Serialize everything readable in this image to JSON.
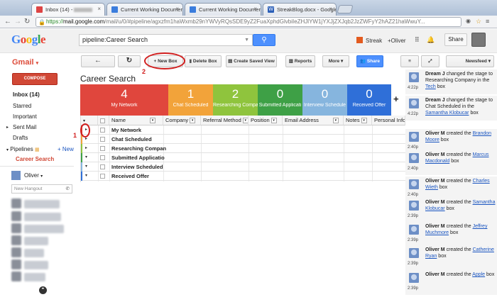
{
  "browser": {
    "tabs": [
      {
        "title": "Inbox (14) - ",
        "favicon": "gmail-icon"
      },
      {
        "title": "Current Working Documer",
        "favicon": "docs-icon"
      },
      {
        "title": "Current Working Documer",
        "favicon": "docs-icon"
      },
      {
        "title": "StreakBlog.docx - Google",
        "favicon": "word-icon"
      }
    ],
    "url_scheme": "https://",
    "url_host": "mail.google.com",
    "url_path": "/mail/u/0/#pipeline/agxzfm1haWxmb29nYWVyRQsSDE9yZ2FuaXphdGlvbiIeZHJlYW1jYXJjZXJqb2JzZWFyY2hAZ21haWwuY..."
  },
  "header": {
    "logo": "Google",
    "search_value": "pipeline:Career Search",
    "streak_label": "Streak",
    "plus_user": "+Oliver",
    "share_label": "Share"
  },
  "sidebar": {
    "app_label": "Gmail",
    "compose_label": "COMPOSE",
    "items": [
      {
        "label": "Inbox (14)",
        "bold": true
      },
      {
        "label": "Starred"
      },
      {
        "label": "Important"
      },
      {
        "label": "Sent Mail"
      },
      {
        "label": "Drafts"
      }
    ],
    "pipelines_label": "Pipelines",
    "new_label": "+ New",
    "active_pipeline": "Career Search",
    "chat_user": "Oliver",
    "hangout_placeholder": "New Hangout"
  },
  "toolbar": {
    "back_label": "←",
    "refresh_label": "↻",
    "new_box_label": "+ New Box",
    "delete_box_label": "Delete Box",
    "saved_view_label": "Create Saved View",
    "reports_label": "Reports",
    "more_label": "More",
    "share_label": "Share",
    "sort_label": "Newsfeed"
  },
  "pipeline": {
    "title": "Career Search",
    "stages": [
      {
        "count": "4",
        "name": "My Network",
        "color": "#e0463d"
      },
      {
        "count": "1",
        "name": "Chat Scheduled",
        "color": "#f2a33a"
      },
      {
        "count": "2",
        "name": "Researching Compa",
        "color": "#8fc43d"
      },
      {
        "count": "0",
        "name": "Submitted Applicati",
        "color": "#3ea046"
      },
      {
        "count": "0",
        "name": "Interview Schedule",
        "color": "#86b5de"
      },
      {
        "count": "0",
        "name": "Received Offer",
        "color": "#2f6fd8"
      }
    ],
    "add_stage": "+"
  },
  "grid": {
    "columns": [
      "Name",
      "Company",
      "Referral Method",
      "Position",
      "Email Address",
      "Notes",
      "Personal Info"
    ],
    "rows": [
      {
        "name": "My Network",
        "color": "#e0463d",
        "arrow": "▸"
      },
      {
        "name": "Chat Scheduled",
        "color": "#f2a33a",
        "arrow": "▸"
      },
      {
        "name": "Researching Compan",
        "color": "#8fc43d",
        "arrow": "▸"
      },
      {
        "name": "Submitted Applicatio",
        "color": "#3ea046",
        "arrow": "▾"
      },
      {
        "name": "Interview Scheduled",
        "color": "#86b5de",
        "arrow": "▾"
      },
      {
        "name": "Received Offer",
        "color": "#2f6fd8",
        "arrow": "▾"
      }
    ]
  },
  "annotations": {
    "one": "1",
    "two": "2"
  },
  "feed": [
    {
      "time": "4:22p",
      "user": "Dream J",
      "pre": "changed the stage to Researching Company in the",
      "link": "Tech",
      "post": "box"
    },
    {
      "time": "4:22p",
      "user": "Dream J",
      "pre": "changed the stage to Chat Scheduled in the",
      "link": "Samantha Klobucar",
      "post": "box"
    },
    {
      "time": "2:40p",
      "user": "Oliver M",
      "pre": "created the",
      "link": "Brandon Moore",
      "post": "box"
    },
    {
      "time": "2:40p",
      "user": "Oliver M",
      "pre": "created the",
      "link": "Marcus Macdonald",
      "post": "box"
    },
    {
      "time": "2:40p",
      "user": "Oliver M",
      "pre": "created the",
      "link": "Charles Wieth",
      "post": "box"
    },
    {
      "time": "2:39p",
      "user": "Oliver M",
      "pre": "created the",
      "link": "Samantha Klobucar",
      "post": "box"
    },
    {
      "time": "2:39p",
      "user": "Oliver M",
      "pre": "created the",
      "link": "Jeffrey Muchmore",
      "post": "box"
    },
    {
      "time": "2:39p",
      "user": "Oliver M",
      "pre": "created the",
      "link": "Catherine Ryan",
      "post": "box"
    },
    {
      "time": "2:39p",
      "user": "Oliver M",
      "pre": "created the",
      "link": "Apple",
      "post": "box"
    }
  ]
}
